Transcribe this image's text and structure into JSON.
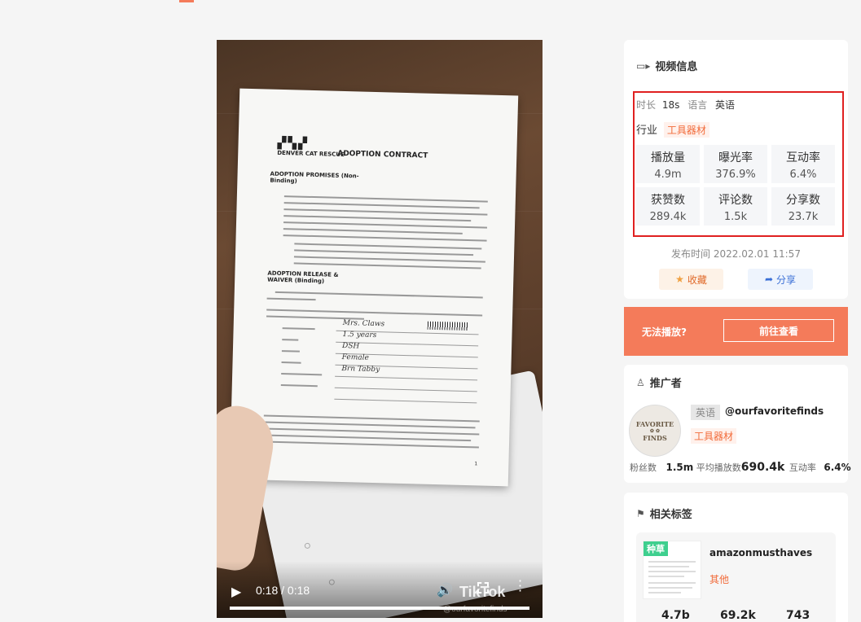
{
  "video": {
    "time": "0:18 / 0:18",
    "progress": 1.0,
    "watermark": "TikTok",
    "watermark_handle": "@ourfavoritefinds",
    "document": {
      "org": "DENVER CAT RESCUE",
      "title": "ADOPTION CONTRACT",
      "section1": "ADOPTION PROMISES (Non-Binding)",
      "section2": "ADOPTION RELEASE & WAIVER (Binding)",
      "handwriting": [
        "Mrs. Claws",
        "1.5 years",
        "DSH",
        "Female",
        "Brn Tabby"
      ],
      "page_number": "1"
    }
  },
  "info": {
    "title": "视频信息",
    "duration_label": "时长",
    "duration": "18s",
    "language_label": "语言",
    "language": "英语",
    "industry_label": "行业",
    "industry": "工具器材",
    "stats": [
      {
        "label": "播放量",
        "value": "4.9m"
      },
      {
        "label": "曝光率",
        "value": "376.9%"
      },
      {
        "label": "互动率",
        "value": "6.4%"
      },
      {
        "label": "获赞数",
        "value": "289.4k"
      },
      {
        "label": "评论数",
        "value": "1.5k"
      },
      {
        "label": "分享数",
        "value": "23.7k"
      }
    ],
    "publish_time": "发布时间 2022.02.01 11:57",
    "favorite_label": "收藏",
    "share_label": "分享"
  },
  "banner": {
    "text": "无法播放?",
    "button": "前往查看"
  },
  "promoter": {
    "title": "推广者",
    "avatar_text": [
      "FAVORITE",
      "FINDS"
    ],
    "language": "英语",
    "handle": "@ourfavoritefinds",
    "industry": "工具器材",
    "fans_label": "粉丝数",
    "fans": "1.5m",
    "avg_play_label": "平均播放数",
    "avg_play": "690.4k",
    "engagement_label": "互动率",
    "engagement": "6.4%"
  },
  "tags": {
    "title": "相关标签",
    "item": {
      "badge": "种草",
      "name": "amazonmusthaves",
      "category": "其他",
      "numbers": [
        "4.7b",
        "69.2k",
        "743"
      ]
    }
  },
  "colors": {
    "accent": "#f47b5a",
    "highlight_border": "#e02020",
    "tag_orange": "#f26b3a",
    "share_blue": "#3a6fd6"
  }
}
